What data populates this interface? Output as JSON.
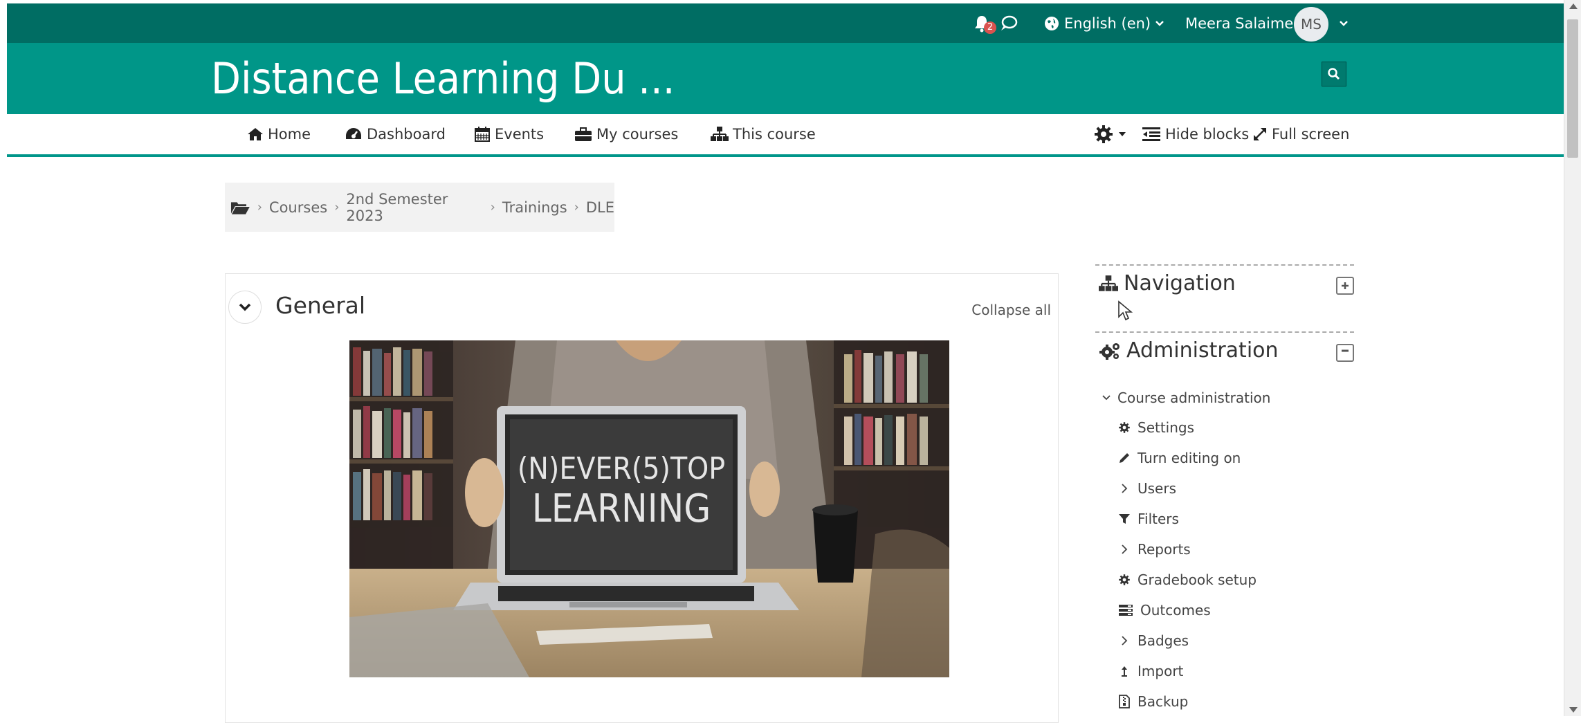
{
  "userbar": {
    "notification_count": "2",
    "language_label": "English (en)",
    "user_name": "Meera Salaimea",
    "avatar_initials": "MS"
  },
  "header": {
    "site_title": "Distance Learning Du ..."
  },
  "nav": {
    "items": [
      {
        "label": "Home",
        "icon": "home-icon"
      },
      {
        "label": "Dashboard",
        "icon": "dashboard-icon"
      },
      {
        "label": "Events",
        "icon": "calendar-icon"
      },
      {
        "label": "My courses",
        "icon": "briefcase-icon"
      },
      {
        "label": "This course",
        "icon": "sitemap-icon"
      }
    ],
    "hide_blocks_label": "Hide blocks",
    "full_screen_label": "Full screen"
  },
  "breadcrumb": {
    "items": [
      "Courses",
      "2nd Semester 2023",
      "Trainings",
      "DLE"
    ]
  },
  "section": {
    "title": "General",
    "collapse_all_label": "Collapse all",
    "image_text_line1": "(N)EVER(5)TOP",
    "image_text_line2": "LEARNING"
  },
  "navigation_block": {
    "title": "Navigation"
  },
  "administration_block": {
    "title": "Administration",
    "root_label": "Course administration",
    "items": [
      {
        "label": "Settings",
        "icon": "gear-icon"
      },
      {
        "label": "Turn editing on",
        "icon": "pencil-icon"
      },
      {
        "label": "Users",
        "icon": "chevron-right-icon"
      },
      {
        "label": "Filters",
        "icon": "filter-icon"
      },
      {
        "label": "Reports",
        "icon": "chevron-right-icon"
      },
      {
        "label": "Gradebook setup",
        "icon": "gear-icon"
      },
      {
        "label": "Outcomes",
        "icon": "outcomes-icon"
      },
      {
        "label": "Badges",
        "icon": "chevron-right-icon"
      },
      {
        "label": "Import",
        "icon": "import-icon"
      },
      {
        "label": "Backup",
        "icon": "backup-icon"
      }
    ]
  },
  "colors": {
    "userbar_bg": "#006d63",
    "header_bg": "#009688",
    "accent": "#00968a"
  }
}
